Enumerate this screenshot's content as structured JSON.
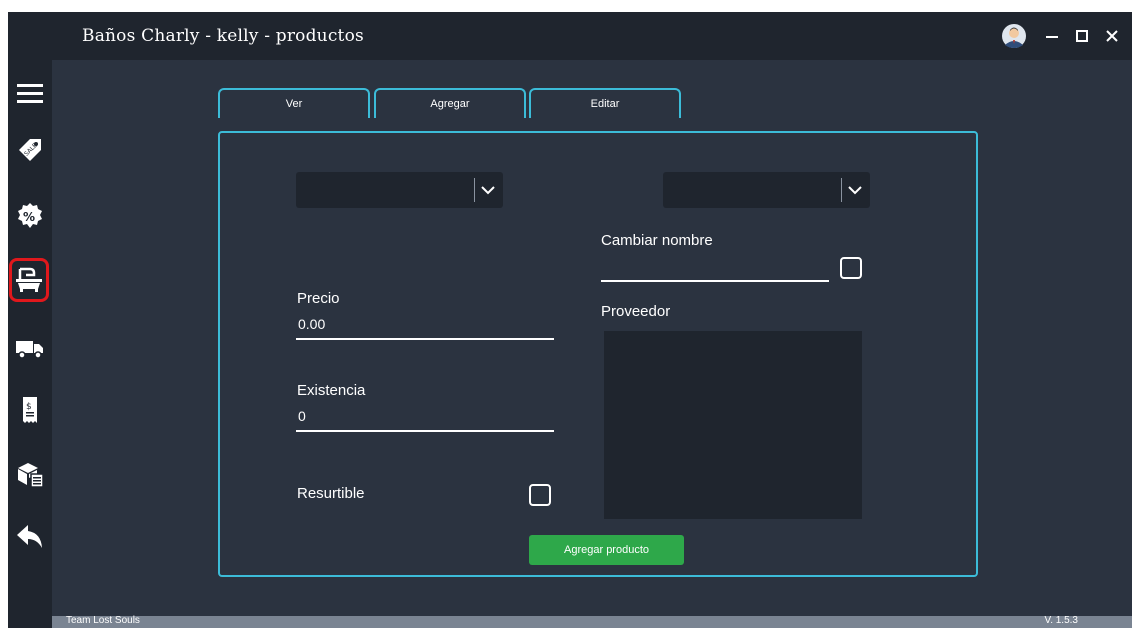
{
  "window": {
    "title": "Baños Charly - kelly - productos"
  },
  "sidebar": {
    "items": [
      {
        "icon": "menu-icon"
      },
      {
        "icon": "sale-tag-icon"
      },
      {
        "icon": "discount-badge-icon"
      },
      {
        "icon": "bathtub-icon",
        "active": true
      },
      {
        "icon": "delivery-truck-icon"
      },
      {
        "icon": "receipt-icon"
      },
      {
        "icon": "inventory-boxes-icon"
      },
      {
        "icon": "back-arrow-icon"
      }
    ]
  },
  "tabs": [
    {
      "label": "Ver"
    },
    {
      "label": "Agregar"
    },
    {
      "label": "Editar"
    }
  ],
  "form": {
    "category_dropdown": {
      "value": ""
    },
    "product_dropdown": {
      "value": ""
    },
    "cambiar_nombre_label": "Cambiar nombre",
    "cambiar_nombre_value": "",
    "precio_label": "Precio",
    "precio_value": "0.00",
    "existencia_label": "Existencia",
    "existencia_value": "0",
    "proveedor_label": "Proveedor",
    "resurtible_label": "Resurtible",
    "submit_label": "Agregar producto"
  },
  "status": {
    "team": "Team Lost Souls",
    "version": "V. 1.5.3"
  },
  "colors": {
    "accent": "#3cbcd8",
    "button": "#2ea84a",
    "active_highlight": "#e0181c"
  }
}
